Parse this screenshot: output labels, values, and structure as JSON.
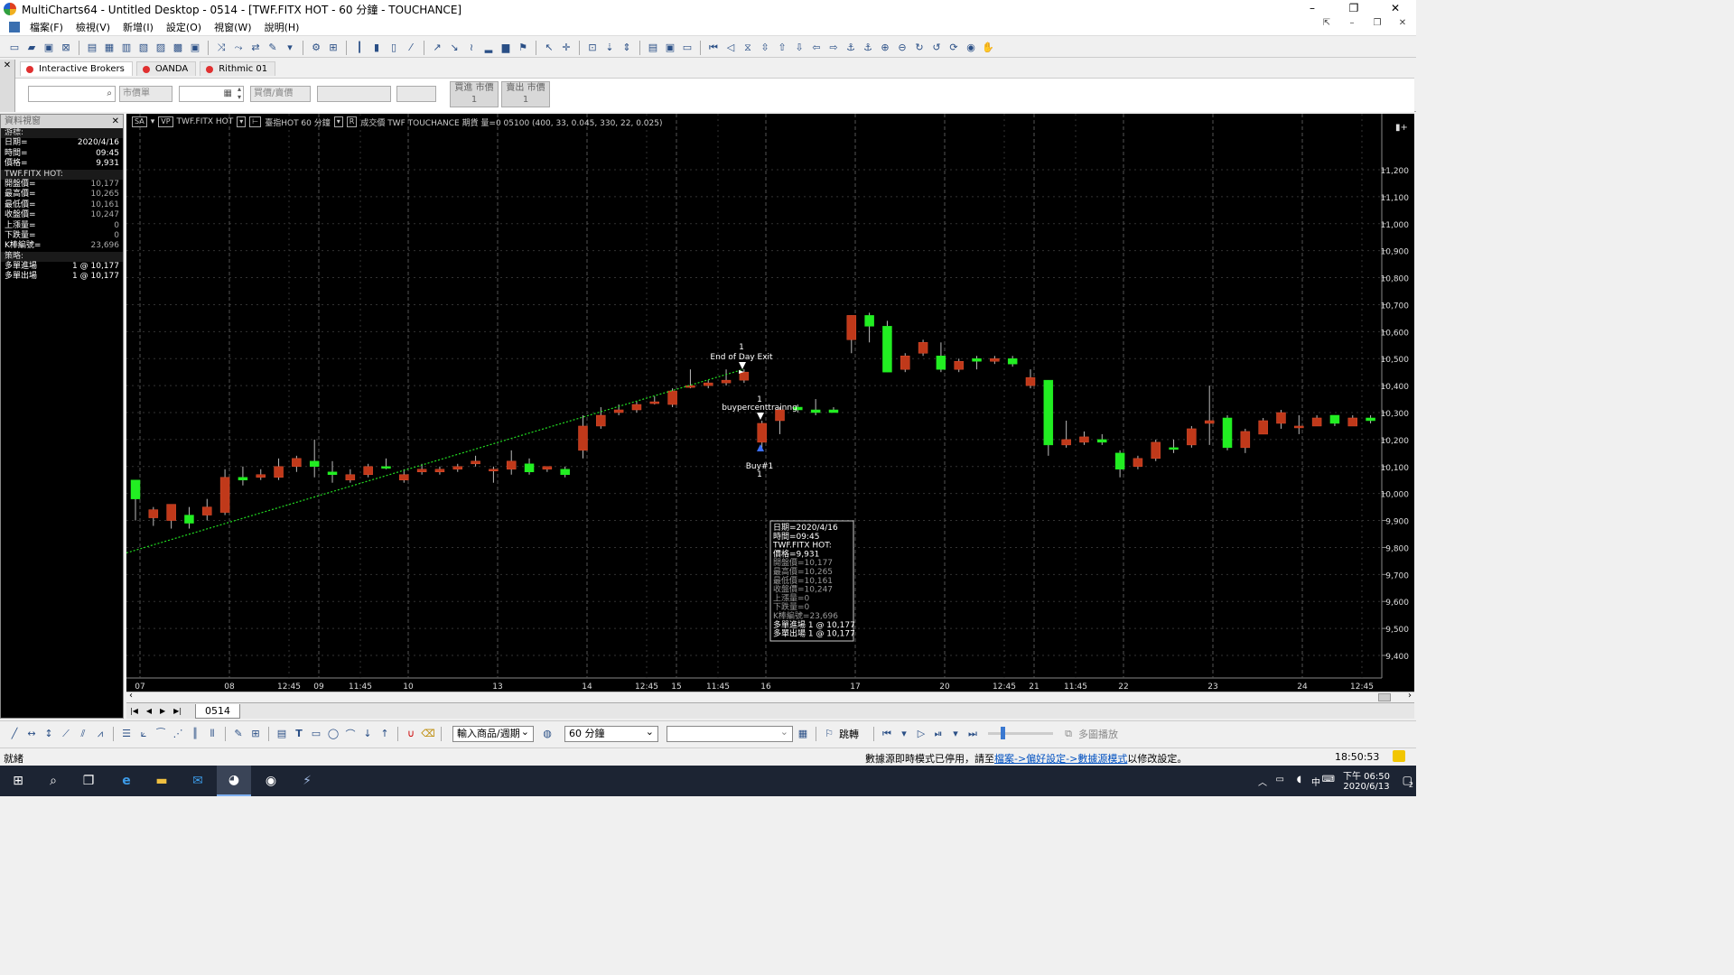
{
  "window": {
    "title": "MultiCharts64 - Untitled Desktop - 0514 - [TWF.FITX HOT - 60 分鐘 - TOUCHANCE]",
    "buttons": [
      "–",
      "❐",
      "✕"
    ]
  },
  "menu": {
    "items": [
      "檔案(F)",
      "檢視(V)",
      "新增(I)",
      "設定(O)",
      "視窗(W)",
      "說明(H)"
    ]
  },
  "trading": {
    "broker_tabs": [
      "Interactive Brokers",
      "OANDA",
      "Rithmic 01"
    ],
    "order_type": "市價單",
    "side": "買價/賣價",
    "buy_market_label": "買進 市價",
    "buy_market_qty": "1",
    "sell_market_label": "賣出 市價",
    "sell_market_qty": "1"
  },
  "data_window": {
    "title": "資料視窗",
    "rows": [
      {
        "label": "游標:",
        "value": "",
        "section": true
      },
      {
        "label": "日期=",
        "value": "2020/4/16"
      },
      {
        "label": "時間=",
        "value": "09:45"
      },
      {
        "label": "價格=",
        "value": "9,931"
      },
      {
        "label": "TWF.FITX HOT:",
        "value": "",
        "section": true
      },
      {
        "label": "開盤價=",
        "value": "10,177",
        "dim": true
      },
      {
        "label": "最高價=",
        "value": "10,265",
        "dim": true
      },
      {
        "label": "最低價=",
        "value": "10,161",
        "dim": true
      },
      {
        "label": "收盤價=",
        "value": "10,247",
        "dim": true
      },
      {
        "label": "上漲量=",
        "value": "0",
        "dim": true
      },
      {
        "label": "下跌量=",
        "value": "0",
        "dim": true
      },
      {
        "label": "K棒編號=",
        "value": "23,696",
        "dim": true
      },
      {
        "label": "策略:",
        "value": "",
        "section": true
      },
      {
        "label": "多單進場",
        "value": "1 @ 10,177"
      },
      {
        "label": "多單出場",
        "value": "1 @ 10,177"
      }
    ]
  },
  "chart_header": {
    "sa": "SA",
    "vp": "VP",
    "symbol": "TWF.FITX HOT",
    "data2": "臺指HOT 60 分鐘",
    "r_label": "R",
    "info": "成交價 TWF TOUCHANCE 期貨 量=0 05100 (400, 33, 0.045, 330, 22, 0.025)"
  },
  "chart_data": {
    "type": "candlestick",
    "y_ticks": [
      "11,200",
      "11,100",
      "11,000",
      "10,900",
      "10,800",
      "10,700",
      "10,600",
      "10,500",
      "10,400",
      "10,300",
      "10,200",
      "10,100",
      "10,000",
      "9,900",
      "9,800",
      "9,700",
      "9,600",
      "9,500",
      "9,400"
    ],
    "ylim": [
      9340,
      11330
    ],
    "x_labels": [
      "07",
      "08",
      "12:45",
      "09",
      "11:45",
      "10",
      "13",
      "14",
      "12:45",
      "15",
      "11:45",
      "16",
      "17",
      "20",
      "12:45",
      "21",
      "11:45",
      "22",
      "23",
      "24",
      "12:45"
    ],
    "annotations": [
      {
        "text": "1",
        "x": 821,
        "y": 383
      },
      {
        "text": "End of Day Exit",
        "x": 821,
        "y": 394
      },
      {
        "text": "1",
        "x": 841,
        "y": 441
      },
      {
        "text": "buypercenttrainng",
        "x": 841,
        "y": 450
      },
      {
        "text": "Buy#1",
        "x": 841,
        "y": 515
      },
      {
        "text": "1",
        "x": 841,
        "y": 524
      }
    ],
    "tooltip": [
      "日期=2020/4/16",
      "時間=09:45",
      "TWF.FITX HOT:",
      "價格=9,931",
      "開盤價=10,177",
      "最高價=10,265",
      "最低價=10,161",
      "收盤價=10,247",
      "上漲量=0",
      "下跌量=0",
      "K棒編號=23,696",
      "多單進場 1 @ 10,177",
      "多單出場 1 @ 10,177"
    ],
    "candles": [
      [
        10050,
        10020,
        9980,
        9900,
        1
      ],
      [
        9940,
        9950,
        9910,
        9880,
        0
      ],
      [
        9960,
        9930,
        9900,
        9870,
        0
      ],
      [
        9920,
        9950,
        9890,
        9870,
        1
      ],
      [
        9950,
        9980,
        9920,
        9900,
        0
      ],
      [
        10060,
        10090,
        9930,
        9920,
        0
      ],
      [
        10060,
        10100,
        10050,
        10030,
        1
      ],
      [
        10070,
        10090,
        10060,
        10050,
        0
      ],
      [
        10100,
        10130,
        10060,
        10050,
        0
      ],
      [
        10130,
        10140,
        10100,
        10080,
        0
      ],
      [
        10100,
        10200,
        10120,
        10060,
        1
      ],
      [
        10080,
        10120,
        10070,
        10040,
        1
      ],
      [
        10070,
        10090,
        10050,
        10040,
        0
      ],
      [
        10100,
        10110,
        10070,
        10060,
        0
      ],
      [
        10100,
        10130,
        10100,
        10090,
        1
      ],
      [
        10070,
        10090,
        10050,
        10040,
        0
      ],
      [
        10090,
        10110,
        10080,
        10070,
        0
      ],
      [
        10090,
        10100,
        10080,
        10070,
        0
      ],
      [
        10100,
        10110,
        10090,
        10080,
        0
      ],
      [
        10120,
        10140,
        10110,
        10100,
        0
      ],
      [
        10090,
        10100,
        10090,
        10040,
        0
      ],
      [
        10120,
        10160,
        10090,
        10070,
        0
      ],
      [
        10110,
        10130,
        10080,
        10070,
        1
      ],
      [
        10100,
        10100,
        10090,
        10080,
        0
      ],
      [
        10090,
        10100,
        10070,
        10060,
        1
      ],
      [
        10250,
        10290,
        10160,
        10130,
        0
      ],
      [
        10290,
        10320,
        10250,
        10240,
        0
      ],
      [
        10310,
        10330,
        10300,
        10290,
        0
      ],
      [
        10330,
        10340,
        10310,
        10300,
        0
      ],
      [
        10340,
        10360,
        10340,
        10330,
        0
      ],
      [
        10380,
        10390,
        10330,
        10320,
        0
      ],
      [
        10400,
        10460,
        10400,
        10390,
        0
      ],
      [
        10410,
        10420,
        10400,
        10390,
        0
      ],
      [
        10420,
        10460,
        10410,
        10400,
        0
      ],
      [
        10450,
        10460,
        10420,
        10410,
        0
      ],
      [
        10260,
        10270,
        10190,
        10170,
        0
      ],
      [
        10270,
        10320,
        10310,
        10220,
        0
      ],
      [
        10320,
        10330,
        10310,
        10300,
        1
      ],
      [
        10310,
        10350,
        10300,
        10290,
        1
      ],
      [
        10310,
        10320,
        10300,
        10300,
        1
      ],
      [
        10660,
        10660,
        10570,
        10520,
        0
      ],
      [
        10660,
        10670,
        10620,
        10560,
        1
      ],
      [
        10620,
        10640,
        10450,
        10450,
        1
      ],
      [
        10510,
        10520,
        10460,
        10450,
        0
      ],
      [
        10560,
        10570,
        10520,
        10510,
        0
      ],
      [
        10510,
        10560,
        10460,
        10450,
        1
      ],
      [
        10490,
        10500,
        10460,
        10450,
        0
      ],
      [
        10500,
        10510,
        10490,
        10460,
        1
      ],
      [
        10500,
        10510,
        10490,
        10480,
        0
      ],
      [
        10500,
        10510,
        10480,
        10470,
        1
      ],
      [
        10430,
        10460,
        10400,
        10390,
        0
      ],
      [
        10420,
        10420,
        10180,
        10140,
        1
      ],
      [
        10200,
        10270,
        10180,
        10170,
        0
      ],
      [
        10210,
        10230,
        10190,
        10180,
        0
      ],
      [
        10200,
        10220,
        10190,
        10180,
        1
      ],
      [
        10150,
        10160,
        10090,
        10060,
        1
      ],
      [
        10130,
        10140,
        10100,
        10090,
        0
      ],
      [
        10190,
        10200,
        10130,
        10120,
        0
      ],
      [
        10170,
        10200,
        10170,
        10150,
        1
      ],
      [
        10240,
        10250,
        10180,
        10170,
        0
      ],
      [
        10270,
        10400,
        10260,
        10180,
        0
      ],
      [
        10280,
        10290,
        10170,
        10160,
        1
      ],
      [
        10230,
        10240,
        10170,
        10150,
        0
      ],
      [
        10270,
        10280,
        10220,
        10220,
        0
      ],
      [
        10300,
        10310,
        10260,
        10240,
        0
      ],
      [
        10250,
        10290,
        10250,
        10220,
        0
      ],
      [
        10280,
        10290,
        10250,
        10250,
        0
      ],
      [
        10290,
        10290,
        10260,
        10250,
        1
      ],
      [
        10280,
        10290,
        10250,
        10260,
        0
      ],
      [
        10280,
        10290,
        10270,
        10260,
        1
      ]
    ],
    "trend": {
      "from": 9780,
      "to": 10460
    }
  },
  "sheet": {
    "tab": "0514",
    "nav": [
      "|◀",
      "◀",
      "▶",
      "▶|"
    ]
  },
  "drawbar": {
    "symbol_select": "輸入商品/週期",
    "interval_select": "60 分鐘",
    "jump": "跳轉",
    "multi_playback": "多圖播放"
  },
  "status": {
    "left": "就緒",
    "msg_prefix": "數據源即時模式已停用，請至",
    "msg_link": "檔案->偏好設定->數據源模式",
    "msg_suffix": "以修改設定。",
    "clock": "18:50:53"
  },
  "taskbar": {
    "time": "下午 06:50",
    "date": "2020/6/13",
    "ime": "中",
    "notif": "2"
  }
}
